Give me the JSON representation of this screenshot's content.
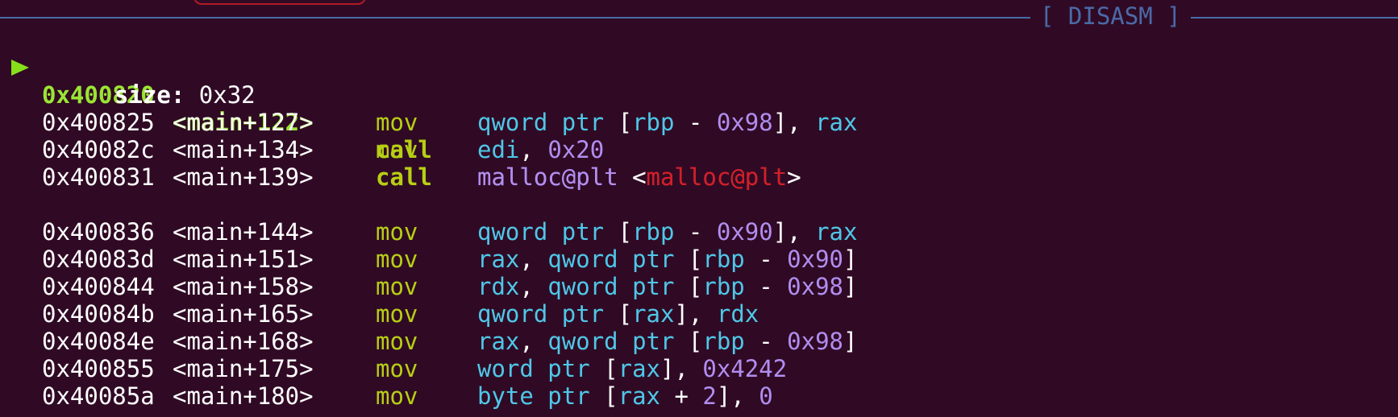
{
  "header": {
    "section_title": "[ DISASM ]"
  },
  "colors": {
    "background": "#300a24",
    "divider": "#4a6aa8",
    "current_line": "#9ae534",
    "mnemonic": "#b7cf14",
    "register": "#4fc7e8",
    "immediate": "#b18ef0",
    "plt_red": "#d0202a"
  },
  "current": {
    "arrow_icon": "current-instruction-arrow-icon",
    "address": "0x400820",
    "symbol": "<main+122>",
    "mnemonic": "call",
    "target_plt": "malloc@plt",
    "target_bracket_open": "<",
    "target_name_red": "malloc@plt",
    "target_bracket_close": ">",
    "arg_label": "size:",
    "arg_value": "0x32"
  },
  "instructions": [
    {
      "address": "0x400825",
      "symbol": "<main+127>",
      "mnemonic": "mov",
      "operands": [
        {
          "t": "kw",
          "v": "qword ptr "
        },
        {
          "t": "punct",
          "v": "["
        },
        {
          "t": "reg",
          "v": "rbp"
        },
        {
          "t": "punct",
          "v": " - "
        },
        {
          "t": "imm",
          "v": "0x98"
        },
        {
          "t": "punct",
          "v": "], "
        },
        {
          "t": "reg",
          "v": "rax"
        }
      ]
    },
    {
      "address": "0x40082c",
      "symbol": "<main+134>",
      "mnemonic": "mov",
      "operands": [
        {
          "t": "reg",
          "v": "edi"
        },
        {
          "t": "punct",
          "v": ", "
        },
        {
          "t": "imm",
          "v": "0x20"
        }
      ]
    },
    {
      "address": "0x400831",
      "symbol": "<main+139>",
      "mnemonic": "call",
      "operands": [
        {
          "t": "plt",
          "v": "malloc@plt "
        },
        {
          "t": "punct",
          "v": "<"
        },
        {
          "t": "plt-red",
          "v": "malloc@plt"
        },
        {
          "t": "punct",
          "v": ">"
        }
      ]
    },
    {
      "address": "0x400836",
      "symbol": "<main+144>",
      "mnemonic": "mov",
      "operands": [
        {
          "t": "kw",
          "v": "qword ptr "
        },
        {
          "t": "punct",
          "v": "["
        },
        {
          "t": "reg",
          "v": "rbp"
        },
        {
          "t": "punct",
          "v": " - "
        },
        {
          "t": "imm",
          "v": "0x90"
        },
        {
          "t": "punct",
          "v": "], "
        },
        {
          "t": "reg",
          "v": "rax"
        }
      ]
    },
    {
      "address": "0x40083d",
      "symbol": "<main+151>",
      "mnemonic": "mov",
      "operands": [
        {
          "t": "reg",
          "v": "rax"
        },
        {
          "t": "punct",
          "v": ", "
        },
        {
          "t": "kw",
          "v": "qword ptr "
        },
        {
          "t": "punct",
          "v": "["
        },
        {
          "t": "reg",
          "v": "rbp"
        },
        {
          "t": "punct",
          "v": " - "
        },
        {
          "t": "imm",
          "v": "0x90"
        },
        {
          "t": "punct",
          "v": "]"
        }
      ]
    },
    {
      "address": "0x400844",
      "symbol": "<main+158>",
      "mnemonic": "mov",
      "operands": [
        {
          "t": "reg",
          "v": "rdx"
        },
        {
          "t": "punct",
          "v": ", "
        },
        {
          "t": "kw",
          "v": "qword ptr "
        },
        {
          "t": "punct",
          "v": "["
        },
        {
          "t": "reg",
          "v": "rbp"
        },
        {
          "t": "punct",
          "v": " - "
        },
        {
          "t": "imm",
          "v": "0x98"
        },
        {
          "t": "punct",
          "v": "]"
        }
      ]
    },
    {
      "address": "0x40084b",
      "symbol": "<main+165>",
      "mnemonic": "mov",
      "operands": [
        {
          "t": "kw",
          "v": "qword ptr "
        },
        {
          "t": "punct",
          "v": "["
        },
        {
          "t": "reg",
          "v": "rax"
        },
        {
          "t": "punct",
          "v": "], "
        },
        {
          "t": "reg",
          "v": "rdx"
        }
      ]
    },
    {
      "address": "0x40084e",
      "symbol": "<main+168>",
      "mnemonic": "mov",
      "operands": [
        {
          "t": "reg",
          "v": "rax"
        },
        {
          "t": "punct",
          "v": ", "
        },
        {
          "t": "kw",
          "v": "qword ptr "
        },
        {
          "t": "punct",
          "v": "["
        },
        {
          "t": "reg",
          "v": "rbp"
        },
        {
          "t": "punct",
          "v": " - "
        },
        {
          "t": "imm",
          "v": "0x98"
        },
        {
          "t": "punct",
          "v": "]"
        }
      ]
    },
    {
      "address": "0x400855",
      "symbol": "<main+175>",
      "mnemonic": "mov",
      "operands": [
        {
          "t": "kw",
          "v": "word ptr "
        },
        {
          "t": "punct",
          "v": "["
        },
        {
          "t": "reg",
          "v": "rax"
        },
        {
          "t": "punct",
          "v": "], "
        },
        {
          "t": "imm",
          "v": "0x4242"
        }
      ]
    },
    {
      "address": "0x40085a",
      "symbol": "<main+180>",
      "mnemonic": "mov",
      "operands": [
        {
          "t": "kw",
          "v": "byte ptr "
        },
        {
          "t": "punct",
          "v": "["
        },
        {
          "t": "reg",
          "v": "rax"
        },
        {
          "t": "punct",
          "v": " + "
        },
        {
          "t": "imm",
          "v": "2"
        },
        {
          "t": "punct",
          "v": "], "
        },
        {
          "t": "imm",
          "v": "0"
        }
      ]
    }
  ]
}
